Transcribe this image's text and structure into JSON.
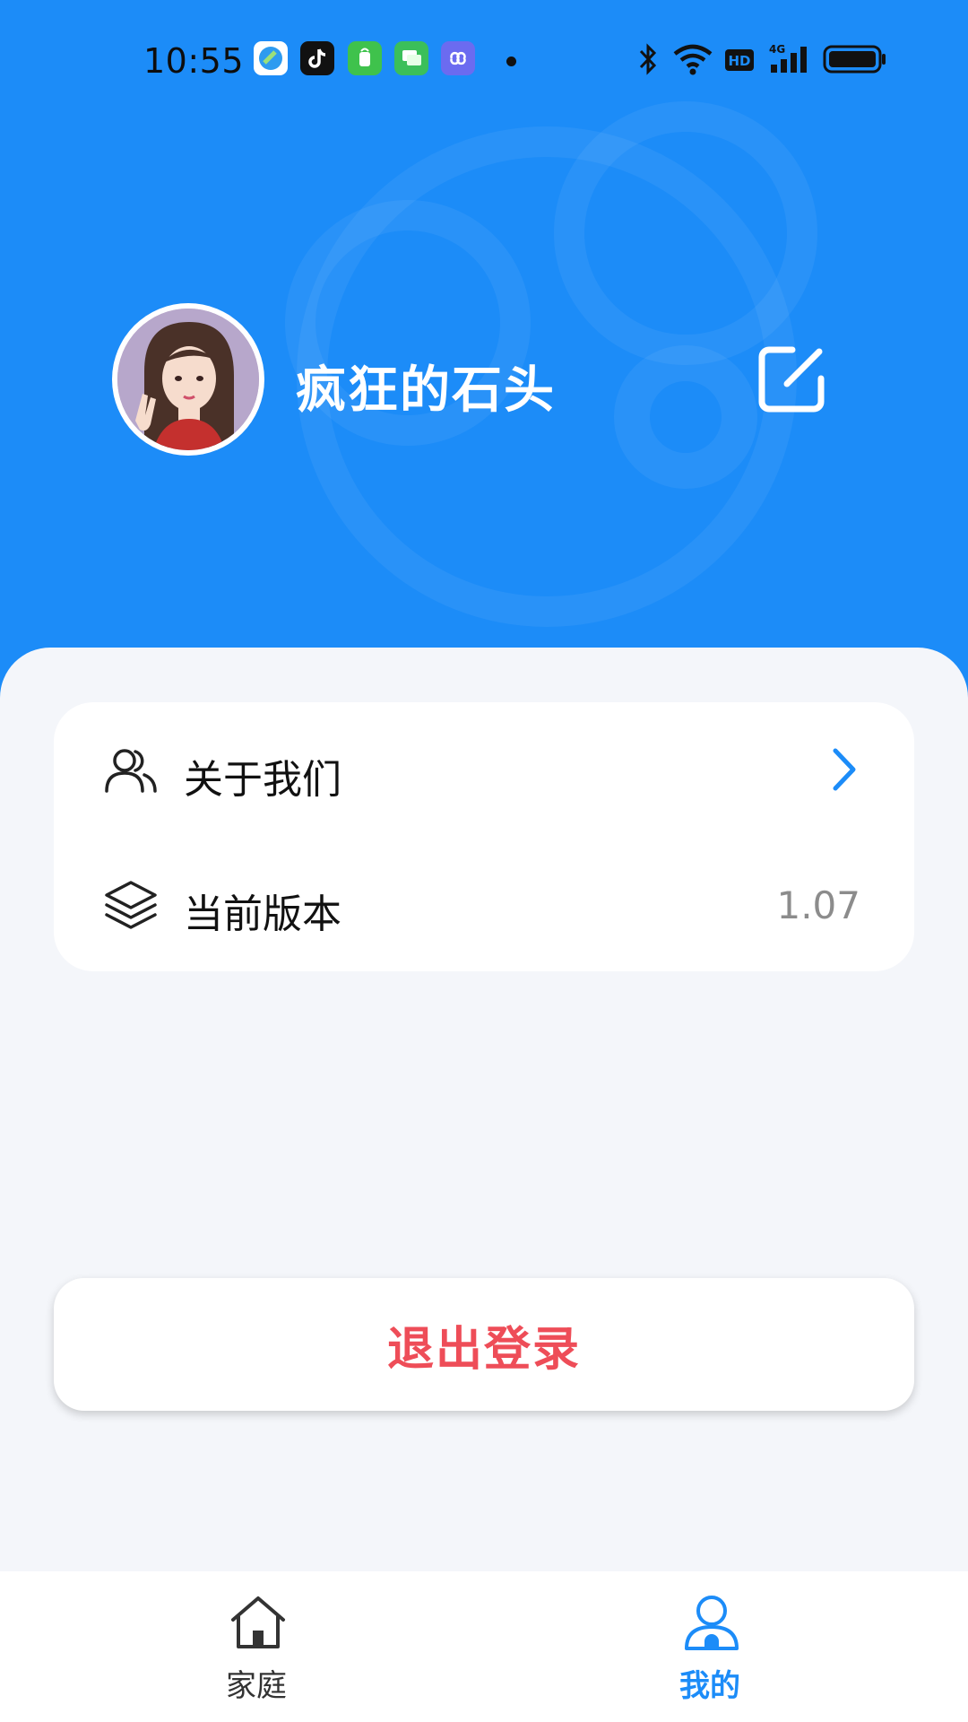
{
  "status_bar": {
    "time": "10:55",
    "notification_icons": [
      "browser-icon",
      "tiktok-icon",
      "app-store-icon",
      "messages-icon",
      "link-app-icon"
    ],
    "indicators": [
      "bluetooth-icon",
      "wifi-icon",
      "hd-icon",
      "signal-4g-icon",
      "battery-icon"
    ]
  },
  "profile": {
    "username": "疯狂的石头",
    "edit_icon": "edit-icon"
  },
  "menu": {
    "items": [
      {
        "label": "关于我们",
        "icon": "users-icon",
        "trailing": "chevron-right-icon"
      },
      {
        "label": "当前版本",
        "icon": "layers-icon",
        "value": "1.07"
      }
    ]
  },
  "logout": {
    "label": "退出登录"
  },
  "tabbar": {
    "tabs": [
      {
        "label": "家庭",
        "icon": "home-icon",
        "active": false
      },
      {
        "label": "我的",
        "icon": "person-icon",
        "active": true
      }
    ]
  },
  "colors": {
    "primary": "#1c8cf8",
    "danger": "#ee4d58",
    "background": "#f4f6fa"
  }
}
